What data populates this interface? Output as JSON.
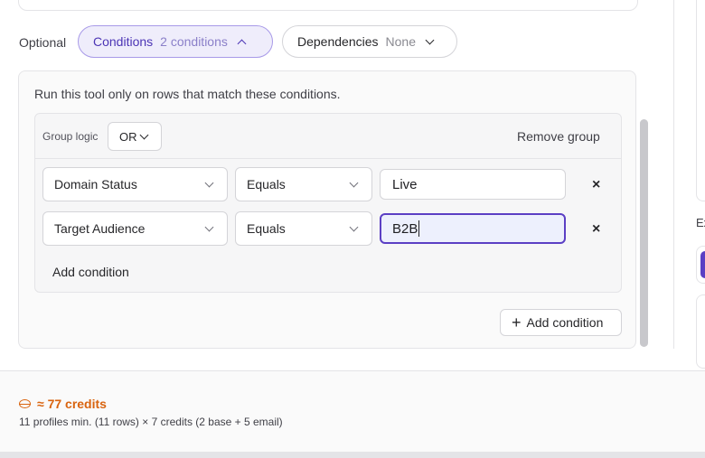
{
  "optional_label": "Optional",
  "pills": {
    "conditions": {
      "label": "Conditions",
      "summary": "2 conditions"
    },
    "dependencies": {
      "label": "Dependencies",
      "summary": "None"
    }
  },
  "conditions_panel": {
    "description": "Run this tool only on rows that match these conditions.",
    "group": {
      "logic_label": "Group logic",
      "logic_value": "OR",
      "remove_label": "Remove group",
      "rows": [
        {
          "field": "Domain Status",
          "operator": "Equals",
          "value": "Live"
        },
        {
          "field": "Target Audience",
          "operator": "Equals",
          "value": "B2B"
        }
      ],
      "add_condition_label": "Add condition"
    },
    "add_condition_button": "Add condition"
  },
  "remove_glyph": "×",
  "right_panel": {
    "label_fragment": "Ex"
  },
  "footer": {
    "credits": "≈ 77 credits",
    "detail": "11 profiles min. (11 rows) × 7 credits (2 base + 5 email)"
  }
}
